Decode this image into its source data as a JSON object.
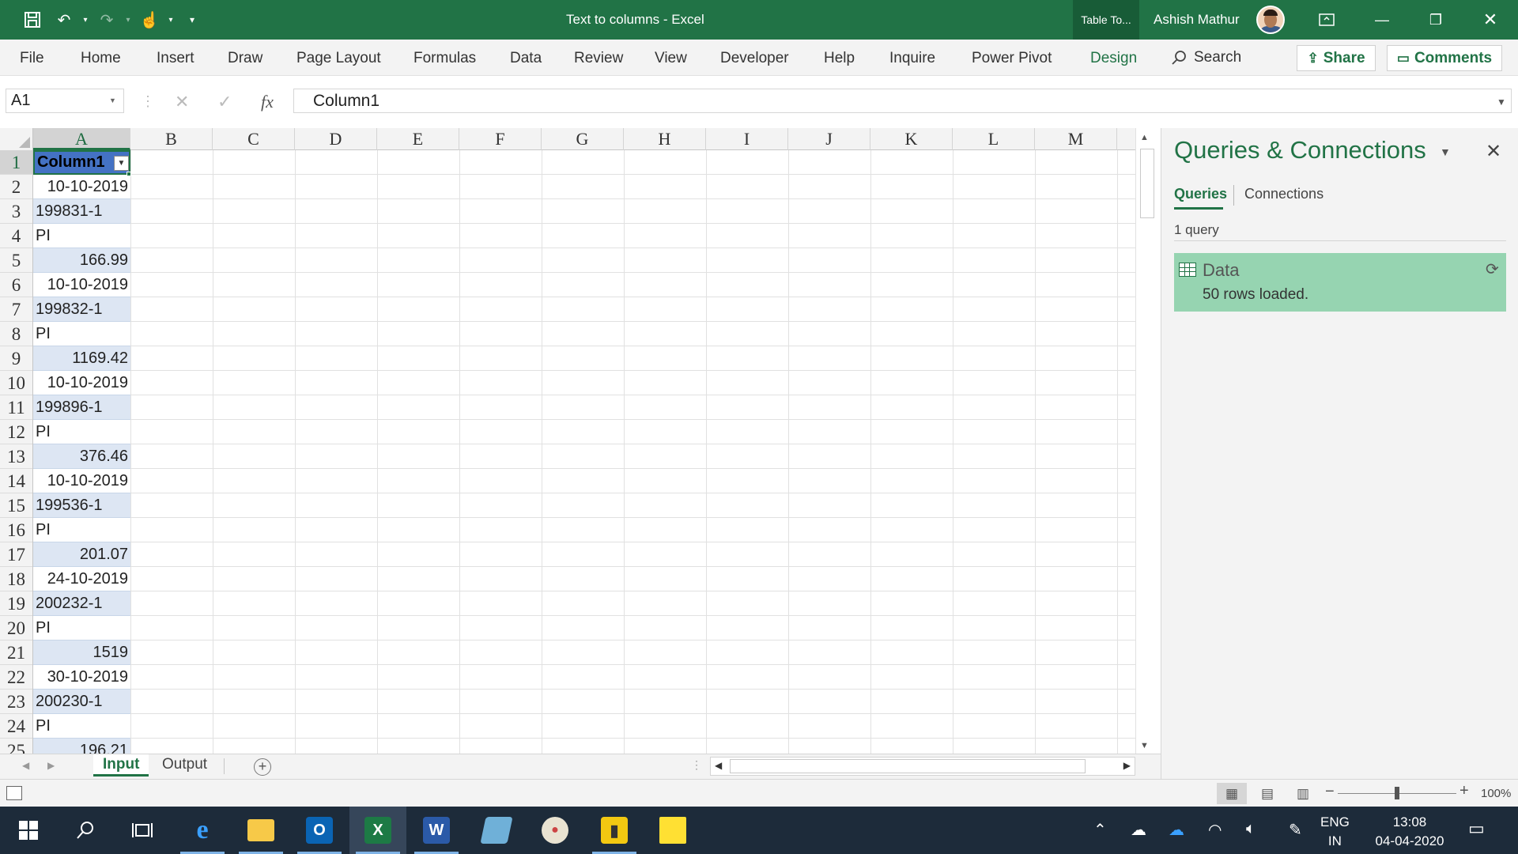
{
  "window": {
    "title": "Text to columns  -  Excel",
    "contextual_tab": "Table To...",
    "user_name": "Ashish Mathur"
  },
  "ribbon": {
    "tabs": [
      "File",
      "Home",
      "Insert",
      "Draw",
      "Page Layout",
      "Formulas",
      "Data",
      "Review",
      "View",
      "Developer",
      "Help",
      "Inquire",
      "Power Pivot",
      "Design"
    ],
    "active_tab": "Design",
    "search_label": "Search",
    "share_label": "Share",
    "comments_label": "Comments"
  },
  "formula_bar": {
    "name_box": "A1",
    "formula": "Column1",
    "fx": "fx"
  },
  "grid": {
    "columns": [
      "A",
      "B",
      "C",
      "D",
      "E",
      "F",
      "G",
      "H",
      "I",
      "J",
      "K",
      "L",
      "M"
    ],
    "selected_column": "A",
    "rows": [
      "1",
      "2",
      "3",
      "4",
      "5",
      "6",
      "7",
      "8",
      "9",
      "10",
      "11",
      "12",
      "13",
      "14",
      "15",
      "16",
      "17",
      "18",
      "19",
      "20",
      "21",
      "22",
      "23",
      "24",
      "25"
    ],
    "column_a": [
      {
        "text": "Column1",
        "align": "left"
      },
      {
        "text": "10-10-2019",
        "align": "right"
      },
      {
        "text": "199831-1",
        "align": "left"
      },
      {
        "text": "PI",
        "align": "left"
      },
      {
        "text": "166.99",
        "align": "right"
      },
      {
        "text": "10-10-2019",
        "align": "right"
      },
      {
        "text": "199832-1",
        "align": "left"
      },
      {
        "text": "PI",
        "align": "left"
      },
      {
        "text": "1169.42",
        "align": "right"
      },
      {
        "text": "10-10-2019",
        "align": "right"
      },
      {
        "text": "199896-1",
        "align": "left"
      },
      {
        "text": "PI",
        "align": "left"
      },
      {
        "text": "376.46",
        "align": "right"
      },
      {
        "text": "10-10-2019",
        "align": "right"
      },
      {
        "text": "199536-1",
        "align": "left"
      },
      {
        "text": "PI",
        "align": "left"
      },
      {
        "text": "201.07",
        "align": "right"
      },
      {
        "text": "24-10-2019",
        "align": "right"
      },
      {
        "text": "200232-1",
        "align": "left"
      },
      {
        "text": "PI",
        "align": "left"
      },
      {
        "text": "1519",
        "align": "right"
      },
      {
        "text": "30-10-2019",
        "align": "right"
      },
      {
        "text": "200230-1",
        "align": "left"
      },
      {
        "text": "PI",
        "align": "left"
      },
      {
        "text": "196.21",
        "align": "right"
      }
    ]
  },
  "sheets": {
    "tabs": [
      "Input",
      "Output"
    ],
    "active": "Input"
  },
  "queries_pane": {
    "title": "Queries & Connections",
    "tabs": [
      "Queries",
      "Connections"
    ],
    "active_tab": "Queries",
    "count_label": "1 query",
    "items": [
      {
        "name": "Data",
        "status": "50 rows loaded."
      }
    ]
  },
  "status_bar": {
    "zoom": "100%"
  },
  "taskbar": {
    "lang_top": "ENG",
    "lang_bottom": "IN",
    "time": "13:08",
    "date": "04-04-2020",
    "apps": [
      "edge-icon",
      "file-explorer-icon",
      "outlook-icon",
      "excel-icon",
      "word-icon",
      "notepad-icon",
      "paint-icon",
      "power-bi-icon",
      "sticky-notes-icon"
    ]
  },
  "colors": {
    "excel_green": "#217346",
    "table_header": "#4472c4",
    "table_band": "#dde6f3",
    "query_item_bg": "#96d4b1",
    "taskbar_bg": "#1d2b3a"
  }
}
